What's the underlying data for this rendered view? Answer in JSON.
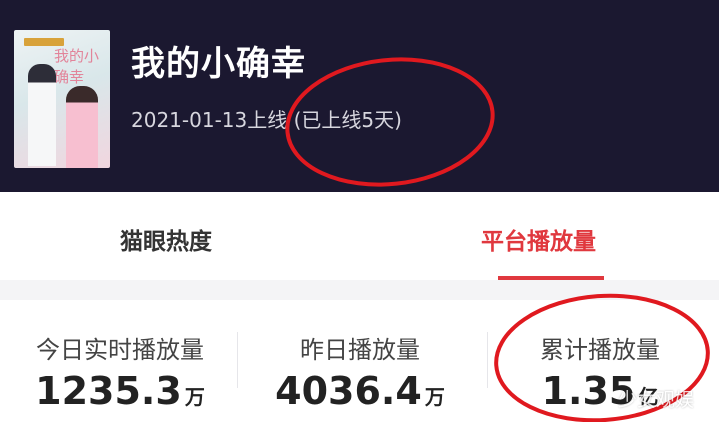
{
  "header": {
    "title": "我的小确幸",
    "release_text": "2021-01-13上线 (已上线5天)",
    "poster_script": "我的小确幸"
  },
  "tabs": [
    {
      "label": "猫眼热度",
      "active": false
    },
    {
      "label": "平台播放量",
      "active": true
    }
  ],
  "stats": [
    {
      "label": "今日实时播放量",
      "value": "1235.3",
      "unit": "万"
    },
    {
      "label": "昨日播放量",
      "value": "4036.4",
      "unit": "万"
    },
    {
      "label": "累计播放量",
      "value": "1.35",
      "unit": "亿"
    }
  ],
  "watermark": "少女观娱",
  "colors": {
    "header_bg": "#1b1830",
    "accent": "#e0383e",
    "annotation_circle": "#e0191f"
  }
}
